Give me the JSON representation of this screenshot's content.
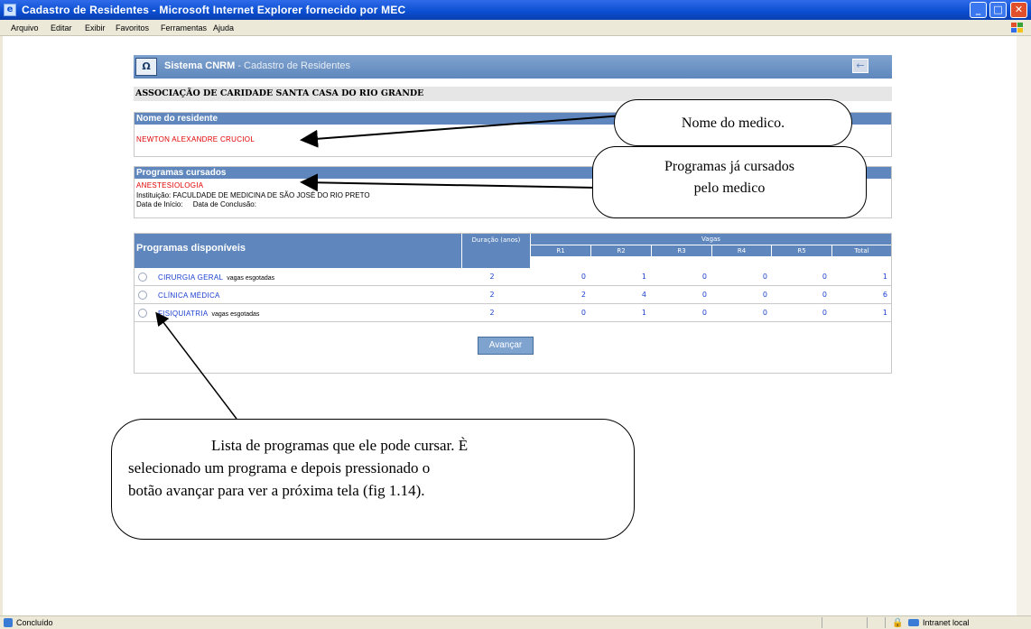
{
  "window": {
    "title": "Cadastro de Residentes - Microsoft Internet Explorer fornecido por MEC",
    "menu": [
      "Arquivo",
      "Editar",
      "Exibir",
      "Favoritos",
      "Ferramentas",
      "Ajuda"
    ],
    "status": "Concluído",
    "zone": "Intranet local"
  },
  "app": {
    "brand": "Sistema CNRM",
    "subtitle": "- Cadastro de Residentes",
    "organization": "ASSOCIAÇÃO DE CARIDADE SANTA CASA DO RIO GRANDE"
  },
  "resident": {
    "title": "Nome do residente",
    "name": "NEWTON ALEXANDRE CRUCIOL"
  },
  "courses": {
    "title": "Programas cursados",
    "program": "ANESTESIOLOGIA",
    "institution": "Instituição: FACULDADE DE MEDICINA DE SÃO JOSÉ DO RIO PRETO",
    "dates": "Data de Início:     Data de Conclusão:"
  },
  "available": {
    "title": "Programas disponíveis",
    "duration_header": "Duração (anos)",
    "vagas_header": "Vagas",
    "columns": [
      "R1",
      "R2",
      "R3",
      "R4",
      "R5",
      "Total"
    ],
    "rows": [
      {
        "name": "CIRURGIA GERAL",
        "note": "vagas esgotadas",
        "duration": "2",
        "values": [
          "0",
          "1",
          "0",
          "0",
          "0",
          "1"
        ]
      },
      {
        "name": "CLÍNICA MÉDICA",
        "note": "",
        "duration": "2",
        "values": [
          "2",
          "4",
          "0",
          "0",
          "0",
          "6"
        ]
      },
      {
        "name": "FISIQUIATRIA",
        "note": "vagas esgotadas",
        "duration": "2",
        "values": [
          "0",
          "1",
          "0",
          "0",
          "0",
          "1"
        ]
      }
    ],
    "advance_label": "Avançar"
  },
  "callouts": {
    "doctor_name": "Nome do medico.",
    "courses_line1": "Programas já cursados",
    "courses_line2": "pelo medico",
    "list_line1": "Lista de programas que ele pode cursar. È",
    "list_line2": "selecionado um programa e depois pressionado o",
    "list_line3": "botão avançar para ver a próxima tela (fig 1.14)."
  }
}
